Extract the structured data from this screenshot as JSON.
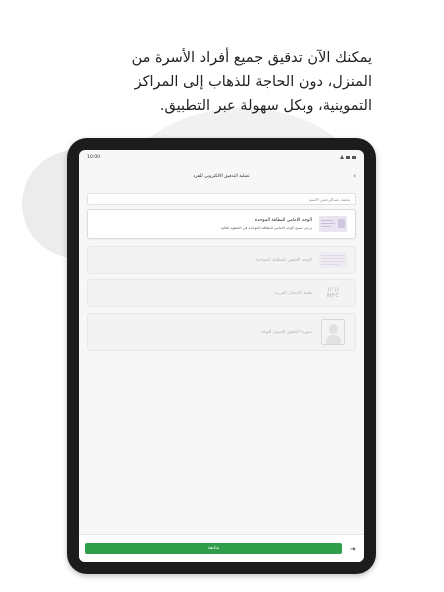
{
  "headline": {
    "line1": "يمكنك الآن تدقيق جميع أفراد الأسرة من",
    "line2": "المنزل، دون الحاجة للذهاب إلى المراكز",
    "line3": "التموينية، وبكل سهولة عبر التطبيق."
  },
  "status_bar": {
    "time": "10:00"
  },
  "nav": {
    "title": "عملية التدقيق الالكتروني للفرد",
    "back_icon": "chevron-right-icon"
  },
  "name_field": {
    "value": "محمد عبدالرحمن الاسم"
  },
  "methods": [
    {
      "title": "الوجه الامامي للبطاقة الموحدة",
      "description": "يرجى مسح الوجه الامامي للبطاقة الموحدة في الخطوة التالية",
      "icon": "id-card-front-icon",
      "state": "active"
    },
    {
      "title": "الوجه الخلفي للبطاقة الموحدة",
      "icon": "id-card-back-icon",
      "state": "disabled"
    },
    {
      "title": "تقنية الاتصال القريب",
      "icon": "nfc-icon",
      "icon_text": "NFC",
      "state": "disabled"
    },
    {
      "title": "صورة التحقق الحيوي للوجه",
      "icon": "face-scan-icon",
      "state": "disabled"
    }
  ],
  "footer": {
    "continue_label": "متابعة",
    "exit_icon": "exit-icon"
  },
  "colors": {
    "accent": "#2f9e4a",
    "tablet_frame": "#1c1c1c",
    "screen_bg": "#f7f7f7"
  }
}
